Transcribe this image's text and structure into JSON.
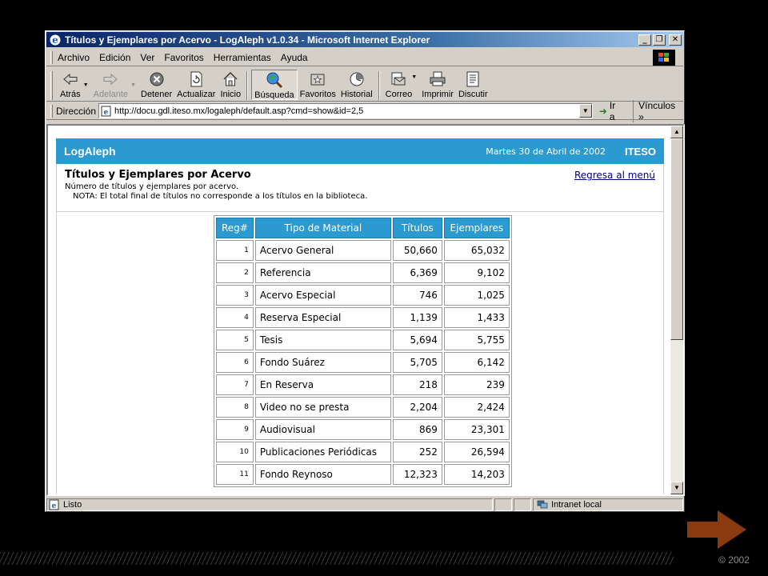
{
  "window": {
    "title": "Títulos y Ejemplares por Acervo - LogAleph v1.0.34 - Microsoft Internet Explorer",
    "minimize_icon": "minimize-icon",
    "restore_icon": "restore-icon",
    "close_icon": "close-icon"
  },
  "menu": {
    "items": [
      "Archivo",
      "Edición",
      "Ver",
      "Favoritos",
      "Herramientas",
      "Ayuda"
    ],
    "underlines": [
      "A",
      "E",
      "V",
      "F",
      "H",
      "y"
    ]
  },
  "toolbar": {
    "buttons": [
      {
        "label": "Atrás",
        "icon": "back-arrow-icon",
        "enabled": true,
        "dropdown": true
      },
      {
        "label": "Adelante",
        "icon": "forward-arrow-icon",
        "enabled": false,
        "dropdown": true
      },
      {
        "label": "Detener",
        "icon": "stop-icon",
        "enabled": true
      },
      {
        "label": "Actualizar",
        "icon": "refresh-icon",
        "enabled": true
      },
      {
        "label": "Inicio",
        "icon": "home-icon",
        "enabled": true
      },
      {
        "label": "Búsqueda",
        "icon": "search-icon",
        "enabled": true,
        "pressed": true
      },
      {
        "label": "Favoritos",
        "icon": "favorites-icon",
        "enabled": true
      },
      {
        "label": "Historial",
        "icon": "history-icon",
        "enabled": true
      },
      {
        "label": "Correo",
        "icon": "mail-icon",
        "enabled": true,
        "dropdown": true
      },
      {
        "label": "Imprimir",
        "icon": "print-icon",
        "enabled": true
      },
      {
        "label": "Discutir",
        "icon": "discuss-icon",
        "enabled": true
      }
    ]
  },
  "address": {
    "label": "Dirección",
    "url": "http://docu.gdl.iteso.mx/logaleph/default.asp?cmd=show&id=2,5",
    "go_label": "Ir a",
    "links_label": "Vínculos"
  },
  "page": {
    "brand": "LogAleph",
    "date": "Martes 30 de Abril de 2002",
    "org": "ITESO",
    "title": "Títulos y Ejemplares por Acervo",
    "subtitle": "Número de títulos y ejemplares por acervo.",
    "note": "NOTA: El total final de títulos no corresponde a los títulos en la biblioteca.",
    "back_link": "Regresa al menú",
    "table": {
      "headers": [
        "Reg#",
        "Tipo de Material",
        "Títulos",
        "Ejemplares"
      ],
      "rows": [
        {
          "reg": "1",
          "tipo": "Acervo General",
          "titulos": "50,660",
          "ejemplares": "65,032"
        },
        {
          "reg": "2",
          "tipo": "Referencia",
          "titulos": "6,369",
          "ejemplares": "9,102"
        },
        {
          "reg": "3",
          "tipo": "Acervo Especial",
          "titulos": "746",
          "ejemplares": "1,025"
        },
        {
          "reg": "4",
          "tipo": "Reserva Especial",
          "titulos": "1,139",
          "ejemplares": "1,433"
        },
        {
          "reg": "5",
          "tipo": "Tesis",
          "titulos": "5,694",
          "ejemplares": "5,755"
        },
        {
          "reg": "6",
          "tipo": "Fondo Suárez",
          "titulos": "5,705",
          "ejemplares": "6,142"
        },
        {
          "reg": "7",
          "tipo": "En Reserva",
          "titulos": "218",
          "ejemplares": "239"
        },
        {
          "reg": "8",
          "tipo": "Video no se presta",
          "titulos": "2,204",
          "ejemplares": "2,424"
        },
        {
          "reg": "9",
          "tipo": "Audiovisual",
          "titulos": "869",
          "ejemplares": "23,301"
        },
        {
          "reg": "10",
          "tipo": "Publicaciones Periódicas",
          "titulos": "252",
          "ejemplares": "26,594"
        },
        {
          "reg": "11",
          "tipo": "Fondo Reynoso",
          "titulos": "12,323",
          "ejemplares": "14,203"
        }
      ]
    }
  },
  "status": {
    "text": "Listo",
    "zone": "Intranet local"
  },
  "slide": {
    "copyright": "© 2002",
    "next_icon": "next-arrow-icon"
  },
  "colors": {
    "accent": "#2b9ad0",
    "title_bar": "#0a246a",
    "arrow": "#8b3a10"
  }
}
